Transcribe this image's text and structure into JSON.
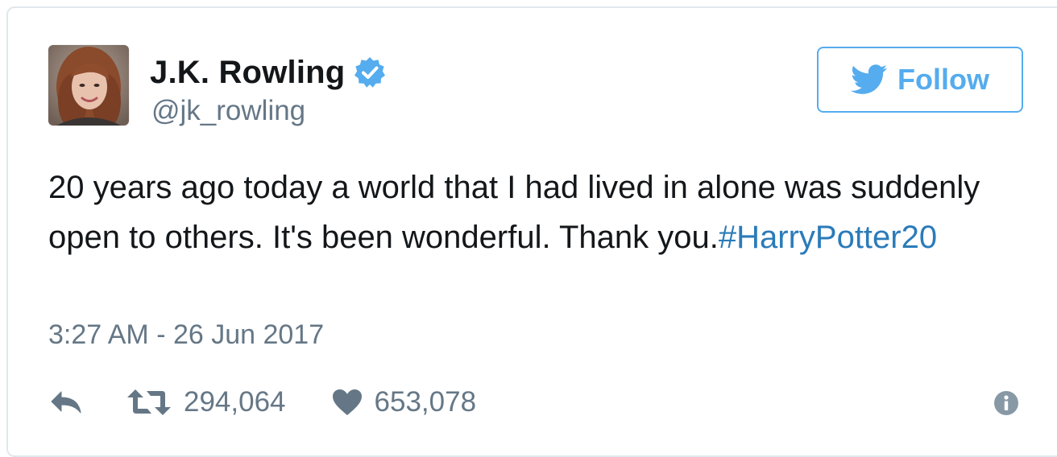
{
  "tweet": {
    "author": {
      "display_name": "J.K. Rowling",
      "handle": "@jk_rowling",
      "verified": true,
      "avatar_icon": "avatar-photo"
    },
    "follow_button": {
      "label": "Follow",
      "icon": "twitter-bird-icon"
    },
    "text": "20 years ago today a world that I had lived in alone was suddenly open to others. It's been wonderful. Thank you.",
    "hashtag": "#HarryPotter20",
    "timestamp": "3:27 AM - 26 Jun 2017",
    "actions": {
      "reply_icon": "reply-icon",
      "retweet_icon": "retweet-icon",
      "retweet_count": "294,064",
      "like_icon": "heart-icon",
      "like_count": "653,078",
      "info_icon": "info-icon"
    }
  },
  "colors": {
    "accent": "#55acee",
    "link": "#2b7bb9",
    "text": "#14171a",
    "muted": "#657786",
    "border": "#e1e8ed"
  }
}
